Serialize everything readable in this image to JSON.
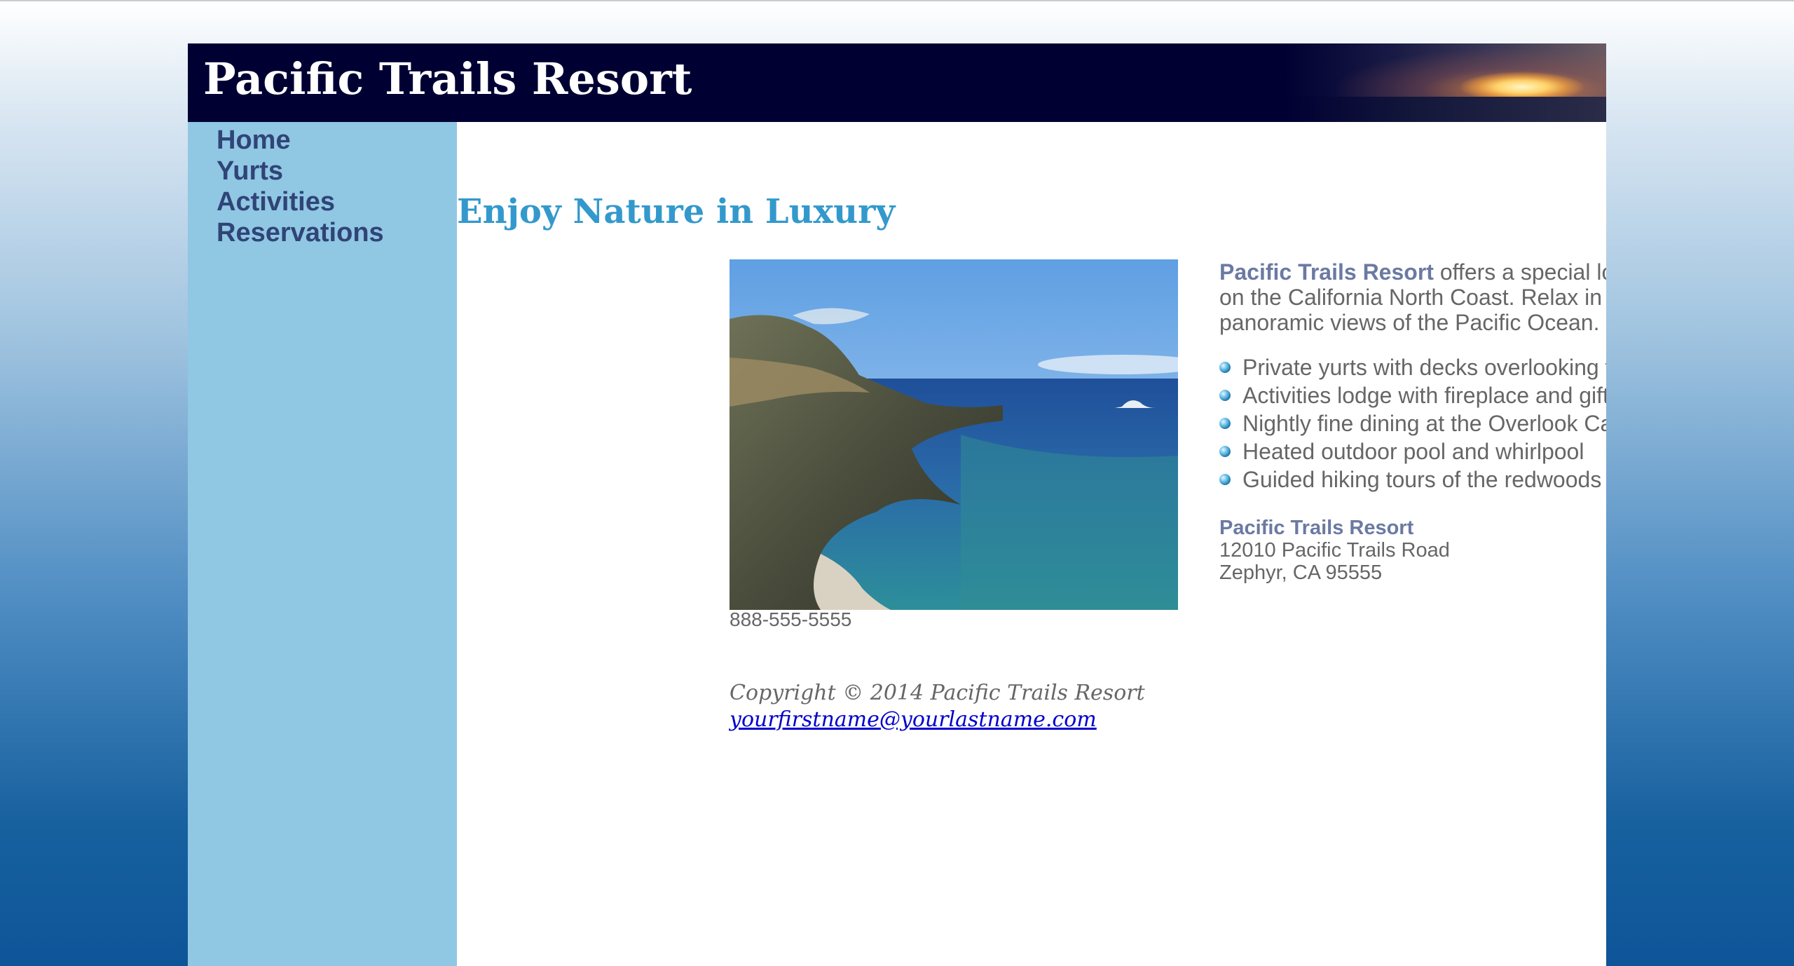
{
  "header": {
    "title": "Pacific Trails Resort"
  },
  "nav": {
    "items": [
      {
        "label": "Home"
      },
      {
        "label": "Yurts"
      },
      {
        "label": "Activities"
      },
      {
        "label": "Reservations"
      }
    ]
  },
  "main": {
    "heading": "Enjoy Nature in Luxury",
    "intro": {
      "resort_name": "Pacific Trails Resort",
      "text": " offers a special lodging experience on the California North Coast. Relax in serenity with panoramic views of the Pacific Ocean."
    },
    "features": [
      "Private yurts with decks overlooking the ocean",
      "Activities lodge with fireplace and gift shop",
      "Nightly fine dining at the Overlook Cafe",
      "Heated outdoor pool and whirlpool",
      "Guided hiking tours of the redwoods"
    ],
    "address": {
      "name": "Pacific Trails Resort",
      "street": "12010 Pacific Trails Road",
      "city_line": "Zephyr, CA 95555"
    },
    "phone": "888-555-5555"
  },
  "footer": {
    "copyright": "Copyright © 2014 Pacific Trails Resort",
    "email": "yourfirstname@yourlastname.com"
  },
  "colors": {
    "header_bg": "#000033",
    "nav_bg": "#90c7e3",
    "nav_text": "#304477",
    "heading": "#3399cc",
    "body_text": "#666666",
    "resort_name": "#6b7aa3"
  }
}
